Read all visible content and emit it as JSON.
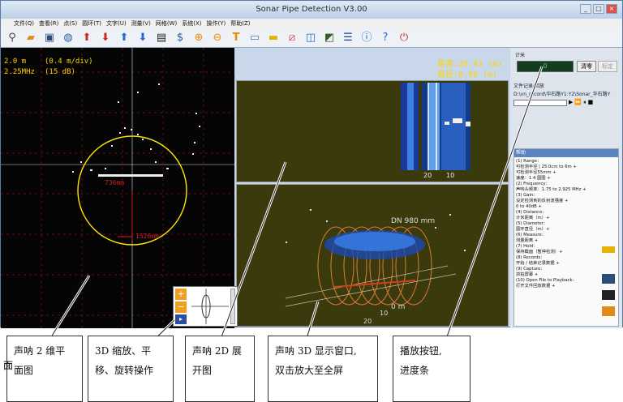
{
  "window": {
    "title": "Sonar Pipe Detection V3.00"
  },
  "menu": [
    "文件(Q)",
    "查看(R)",
    "点(S)",
    "圆环(T)",
    "文字(U)",
    "测量(V)",
    "网格(W)",
    "系统(X)",
    "操作(Y)",
    "帮助(Z)"
  ],
  "view2d": {
    "scale_range": "2.0 m",
    "scale_speed": "(0.4 m/div)",
    "frequency": "2.25MHz",
    "gain": "(15 dB)",
    "distance": "距离:29.43 (m)",
    "diameter": "直径:0.98 (m)",
    "label_inner": "736mm",
    "label_outer": "1526mm"
  },
  "well2d": {
    "tick_left": "20",
    "tick_right": "10"
  },
  "view3d": {
    "dn_label": "DN 980 mm",
    "meter_label": "0 m",
    "tick_a": "10",
    "tick_b": "20"
  },
  "panel": {
    "counter_group": "计米",
    "counter_value": "0",
    "clear_btn": "清零",
    "calib_btn": "标定",
    "record_group": "文件记录/回放",
    "record_path": "D:\\vn_record\\华石路Y1:Y2\\Sonar_华石路Y",
    "help_title": "帮助",
    "help_items": [
      "(1) Range：",
      "可检测半径 | 25.0cm to 6m +",
      "可检测半径55mm +",
      "速度：1.4 圆圈 +",
      "(2) Frequency：",
      "声呐头频率：1.75 to 2.925 MHz +",
      "(3) Gain：",
      "设定检测到的反射波强度 +",
      "0 to 40dB +",
      "(4) Distance：",
      "计米距离（m）+",
      "(5) Diameter：",
      "圆环直径（m）+",
      "(6) Measure：",
      "测量距离 +",
      "(7) Hold：",
      "保持截面（暂停检测）+",
      "(8) Records：",
      "开始 / 结束记录数据 +",
      "(9) Capture：",
      "抓拍屏幕 +",
      "(10) Open File to Playback：",
      "打开文件回放数据 +"
    ]
  },
  "callouts": [
    {
      "lines": [
        "声呐 2 维平",
        "面图"
      ]
    },
    {
      "lines": [
        "3D 缩放、平",
        "移、旋转操作"
      ]
    },
    {
      "lines": [
        "声呐 2D 展",
        "开图"
      ]
    },
    {
      "lines": [
        "声呐 3D 显示窗口,",
        "双击放大至全屏"
      ]
    },
    {
      "lines": [
        "播放按钮,",
        "进度条"
      ]
    }
  ],
  "stray_glyph": "面"
}
